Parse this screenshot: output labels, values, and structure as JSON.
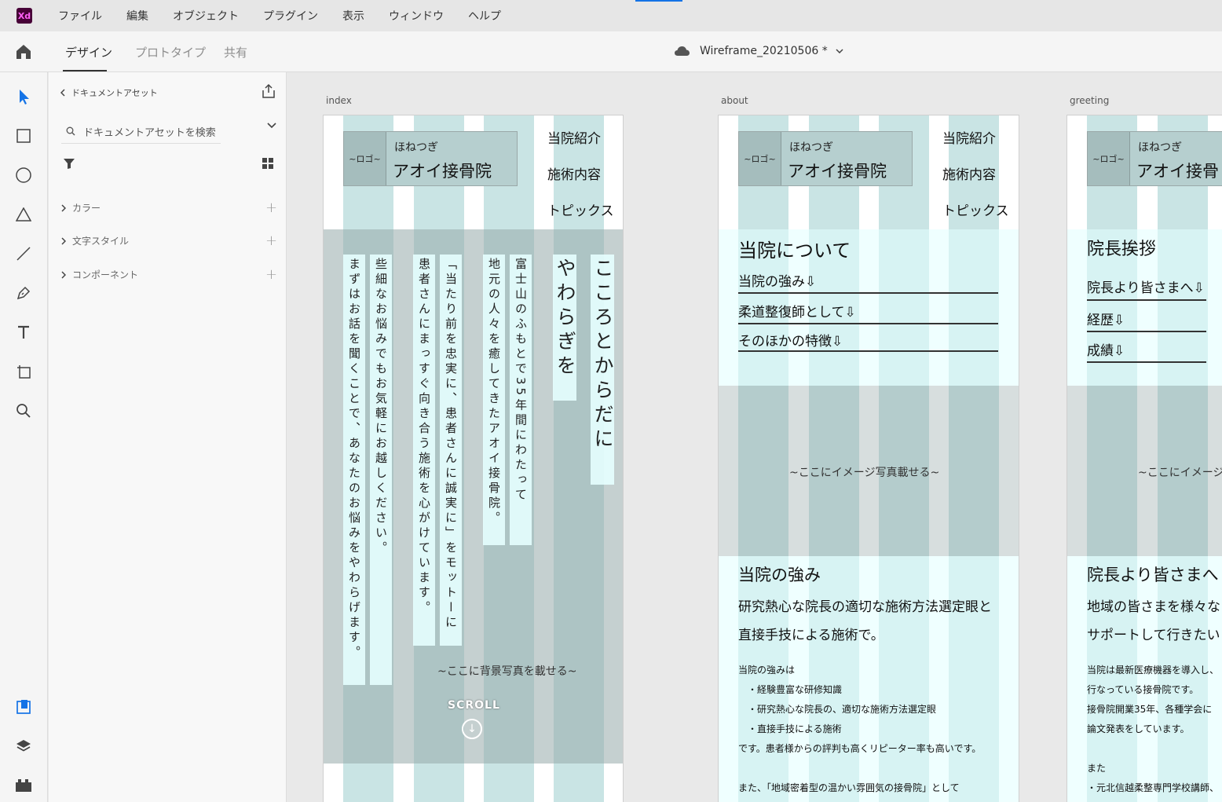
{
  "menubar": {
    "app_icon": "Xd",
    "items": [
      "ファイル",
      "編集",
      "オブジェクト",
      "プラグイン",
      "表示",
      "ウィンドウ",
      "ヘルプ"
    ]
  },
  "tabbar": {
    "tabs": [
      "デザイン",
      "プロトタイプ",
      "共有"
    ],
    "active_tab": "デザイン",
    "document_title": "Wireframe_20210506 *"
  },
  "assets_panel": {
    "title": "ドキュメントアセット",
    "search_placeholder": "ドキュメントアセットを検索",
    "sections": [
      "カラー",
      "文字スタイル",
      "コンポーネント"
    ]
  },
  "colors": {
    "accent": "#1473e6",
    "column_guide": "#c9e4e4",
    "column_guide_light": "#e2ffff",
    "logo_box": "#b6cfcf"
  },
  "artboards": {
    "index": {
      "label": "index",
      "logo": "~ロゴ~",
      "clinic_small": "ほねつぎ",
      "clinic_name": "アオイ接骨院",
      "nav": [
        "当院紹介",
        "施術内容",
        "トピックス"
      ],
      "hero_columns": [
        "こころとからだに",
        "やわらぎを",
        "富士山のふもとで35年間にわたって",
        "地元の人々を癒してきたアオイ接骨院。",
        "「当たり前を忠実に、患者さんに誠実に」をモットーに",
        "患者さんにまっすぐ向き合う施術を心がけています。",
        "些細なお悩みでもお気軽にお越しください。",
        "まずはお話を聞くことで、あなたのお悩みをやわらげます。"
      ],
      "hero_note": "~ここに背景写真を載せる~",
      "scroll_label": "SCROLL"
    },
    "about": {
      "label": "about",
      "logo": "~ロゴ~",
      "clinic_small": "ほねつぎ",
      "clinic_name": "アオイ接骨院",
      "nav": [
        "当院紹介",
        "施術内容",
        "トピックス"
      ],
      "section_title": "当院について",
      "links": [
        "当院の強み⇩",
        "柔道整復師として⇩",
        "そのほかの特徴⇩"
      ],
      "photo_note": "~ここにイメージ写真載せる~",
      "strength_title": "当院の強み",
      "lead_lines": [
        "研究熱心な院長の適切な施術方法選定眼と",
        "直接手技による施術で。"
      ],
      "body_lines": [
        "当院の強みは",
        "・経験豊富な研修知識",
        "・研究熱心な院長の、適切な施術方法選定眼",
        "・直接手技による施術",
        "です。患者様からの評判も高くリピーター率も高いです。",
        "",
        "また、「地域密着型の温かい雰囲気の接骨院」として"
      ]
    },
    "greeting": {
      "label": "greeting",
      "logo": "~ロゴ~",
      "clinic_small": "ほねつぎ",
      "clinic_name": "アオイ接骨",
      "section_title": "院長挨拶",
      "links": [
        "院長より皆さまへ⇩",
        "経歴⇩",
        "成績⇩"
      ],
      "photo_note": "~ここにイメージ",
      "message_title": "院長より皆さまへ",
      "lead_lines": [
        "地域の皆さまを様々な",
        "サポートして行きたい"
      ],
      "body_lines": [
        "当院は最新医療機器を導入し、",
        "行なっている接骨院です。",
        "接骨院開業35年、各種学会に",
        "論文発表をしています。",
        "",
        "また",
        "・元北信越柔整専門学校講師、"
      ]
    }
  }
}
